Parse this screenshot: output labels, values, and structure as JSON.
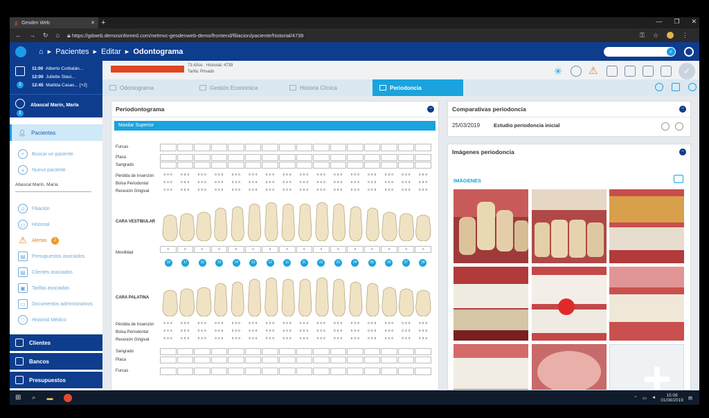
{
  "browser": {
    "tab_title": "Gesden Web",
    "url": "https://gdweb.demosinfomed.com/netmvc-gesdenweb-demo/frontend/filiacion/paciente/historial/4739"
  },
  "header": {
    "crumbs": [
      "Pacientes",
      "Editar"
    ],
    "current": "Odontograma"
  },
  "agenda": {
    "items": [
      {
        "time": "11:00",
        "name": "Alberto Corbalán..."
      },
      {
        "time": "12:00",
        "name": "Juliette Stasi..."
      },
      {
        "time": "12:45",
        "name": "Matilda Casas... [+2]"
      }
    ],
    "count": "5"
  },
  "patient": {
    "name": "Abascal Marin, María",
    "badge": "1",
    "age_line": "73 Años · Historial: 4739",
    "tarifa_line": "Tarifa: Privado"
  },
  "sidebar": {
    "section": "Pacientes",
    "buscar": "Buscar un paciente",
    "nuevo": "Nuevo paciente",
    "subpatient": "Abascal Marín, María",
    "items": [
      "Filiación",
      "Historial",
      "Alertas",
      "Presupuestos asociados",
      "Clientes asociados",
      "Tarifas asociadas",
      "Documentos administrativos",
      "Historial Médico"
    ],
    "alert_count": "2",
    "bottom": [
      "Clientes",
      "Bancos",
      "Presupuestos"
    ]
  },
  "tabs": [
    "Odontograma",
    "Gestión Económica",
    "Historia Clínica",
    "Periodoncia"
  ],
  "perio": {
    "title": "Periodontograma",
    "maxilar": "Maxilar Superior",
    "labels_top": [
      "Furcas",
      "Placa",
      "Sangrado",
      "Pérdida de Inserción",
      "Bolsa Periodontal",
      "Recesión Gingival"
    ],
    "cara_vestibular": "CARA VESTIBULAR",
    "movilidad": "Movilidad",
    "cara_palatina": "CARA PALATINA",
    "labels_bottom": [
      "Pérdida de Inserción",
      "Bolsa Periodontal",
      "Recesión Gingival",
      "Sangrado",
      "Placa",
      "Furcas"
    ],
    "tooth_numbers": [
      "18",
      "17",
      "16",
      "15",
      "14",
      "13",
      "12",
      "11",
      "21",
      "22",
      "23",
      "24",
      "25",
      "26",
      "27",
      "28"
    ],
    "mobility_values": [
      "0",
      "0",
      "0",
      "0",
      "0",
      "0",
      "0",
      "0",
      "0",
      "0",
      "0",
      "0",
      "0",
      "0",
      "0",
      "0"
    ],
    "triplet": "0 0 0"
  },
  "comparativas": {
    "title": "Comparativas periodoncia",
    "date": "25/03/2019",
    "desc": "Estudio periodoncia inicial"
  },
  "imagenes": {
    "title": "Imágenes periodoncia",
    "subtitle": "IMÁGENES"
  },
  "taskbar": {
    "time": "15:08",
    "date": "01/08/2019"
  },
  "colors": {
    "navy": "#0e3d8e",
    "accent": "#1aa3dd",
    "alert": "#e0451f"
  }
}
